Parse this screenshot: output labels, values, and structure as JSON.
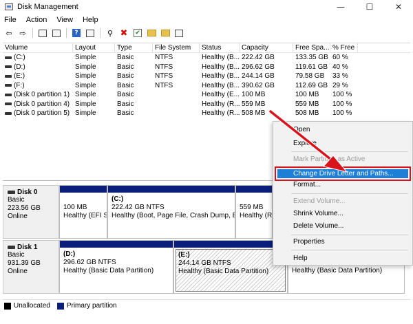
{
  "window": {
    "title": "Disk Management",
    "minimize": "—",
    "maximize": "☐",
    "close": "✕"
  },
  "menu": [
    "File",
    "Action",
    "View",
    "Help"
  ],
  "toolbar": {
    "icons": [
      "back-icon",
      "forward-icon",
      "console-tree-icon",
      "properties-icon",
      "help-icon",
      "connect-icon",
      "delete-icon",
      "check-icon",
      "folder-icon",
      "folder-search-icon",
      "folder-options-icon"
    ],
    "back": "⇦",
    "forward": "⇨",
    "help": "?",
    "delete": "✖",
    "check": "✔",
    "connect": "⚲"
  },
  "table": {
    "headers": [
      "Volume",
      "Layout",
      "Type",
      "File System",
      "Status",
      "Capacity",
      "Free Spa...",
      "% Free"
    ],
    "rows": [
      [
        "(C:)",
        "Simple",
        "Basic",
        "NTFS",
        "Healthy (B...",
        "222.42 GB",
        "133.35 GB",
        "60 %"
      ],
      [
        "(D:)",
        "Simple",
        "Basic",
        "NTFS",
        "Healthy (B...",
        "296.62 GB",
        "119.61 GB",
        "40 %"
      ],
      [
        "(E:)",
        "Simple",
        "Basic",
        "NTFS",
        "Healthy (B...",
        "244.14 GB",
        "79.58 GB",
        "33 %"
      ],
      [
        "(F:)",
        "Simple",
        "Basic",
        "NTFS",
        "Healthy (B...",
        "390.62 GB",
        "112.69 GB",
        "29 %"
      ],
      [
        "(Disk 0 partition 1)",
        "Simple",
        "Basic",
        "",
        "Healthy (E...",
        "100 MB",
        "100 MB",
        "100 %"
      ],
      [
        "(Disk 0 partition 4)",
        "Simple",
        "Basic",
        "",
        "Healthy (R...",
        "559 MB",
        "559 MB",
        "100 %"
      ],
      [
        "(Disk 0 partition 5)",
        "Simple",
        "Basic",
        "",
        "Healthy (R...",
        "508 MB",
        "508 MB",
        "100 %"
      ]
    ]
  },
  "disks": {
    "disk0": {
      "name": "Disk 0",
      "type": "Basic",
      "size": "223.56 GB",
      "status": "Online",
      "partitions": [
        {
          "name": "",
          "size": "100 MB",
          "status": "Healthy (EFI S"
        },
        {
          "name": "(C:)",
          "size": "222.42 GB NTFS",
          "status": "Healthy (Boot, Page File, Crash Dump, Ba"
        },
        {
          "name": "",
          "size": "559 MB",
          "status": "Healthy (Re"
        }
      ]
    },
    "disk1": {
      "name": "Disk 1",
      "type": "Basic",
      "size": "931.39 GB",
      "status": "Online",
      "partitions": [
        {
          "name": "(D:)",
          "size": "296.62 GB NTFS",
          "status": "Healthy (Basic Data Partition)"
        },
        {
          "name": "(E:)",
          "size": "244.14 GB NTFS",
          "status": "Healthy (Basic Data Partition)"
        },
        {
          "name": "",
          "size": "",
          "status": "Healthy (Basic Data Partition)"
        }
      ]
    }
  },
  "legend": {
    "unallocated": "Unallocated",
    "primary": "Primary partition",
    "unallocated_color": "#000000",
    "primary_color": "#0a1f7a"
  },
  "context_menu": {
    "open": "Open",
    "explore": "Explore",
    "mark_active": "Mark Partition as Active",
    "change_drive_letter": "Change Drive Letter and Paths...",
    "format": "Format...",
    "extend": "Extend Volume...",
    "shrink": "Shrink Volume...",
    "delete": "Delete Volume...",
    "properties": "Properties",
    "help": "Help"
  },
  "colors": {
    "highlight": "#1e7fd6",
    "annotation": "#d8131c",
    "partition_bar": "#0a1f7a"
  }
}
